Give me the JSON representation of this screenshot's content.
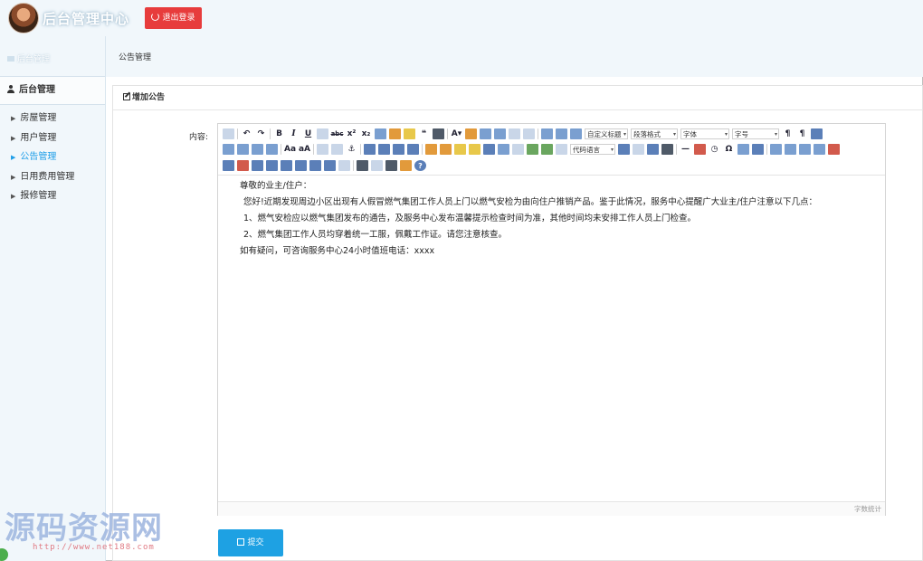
{
  "header": {
    "site_title": "后台管理中心",
    "logout_label": "退出登录"
  },
  "sidebar": {
    "tag": "后台管理",
    "heading": "后台管理",
    "items": [
      {
        "label": "房屋管理",
        "active": false
      },
      {
        "label": "用户管理",
        "active": false
      },
      {
        "label": "公告管理",
        "active": true
      },
      {
        "label": "日用费用管理",
        "active": false
      },
      {
        "label": "报修管理",
        "active": false
      }
    ]
  },
  "breadcrumb": "公告管理",
  "panel": {
    "title": "增加公告"
  },
  "form": {
    "content_label": "内容:",
    "submit_label": "提交"
  },
  "editor": {
    "selects": {
      "custom_title": "自定义标题",
      "paragraph": "段落格式",
      "font": "字体",
      "font_size": "字号",
      "code_lang": "代码语言"
    },
    "paragraphs": [
      "尊敬的业主/住户：",
      "您好!近期发现周边小区出现有人假冒燃气集团工作人员上门以燃气安检为由向住户推销产品。鉴于此情况，服务中心提醒广大业主/住户注意以下几点：",
      "1、燃气安检应以燃气集团发布的通告，及服务中心发布温馨提示检查时间为准，其他时间均未安排工作人员上门检查。",
      "2、燃气集团工作人员均穿着统一工服，佩戴工作证。请您注意核查。",
      "如有疑问，可咨询服务中心24小时值班电话：xxxx"
    ],
    "word_count_label": "字数统计"
  },
  "watermark": {
    "text": "源码资源网",
    "url": "http://www.net188.com"
  },
  "colors": {
    "header_bg": "#f1f7fb",
    "logout_red": "#e73c3c",
    "submit_blue": "#1ea1e3",
    "active_link": "#1e9ee8"
  }
}
